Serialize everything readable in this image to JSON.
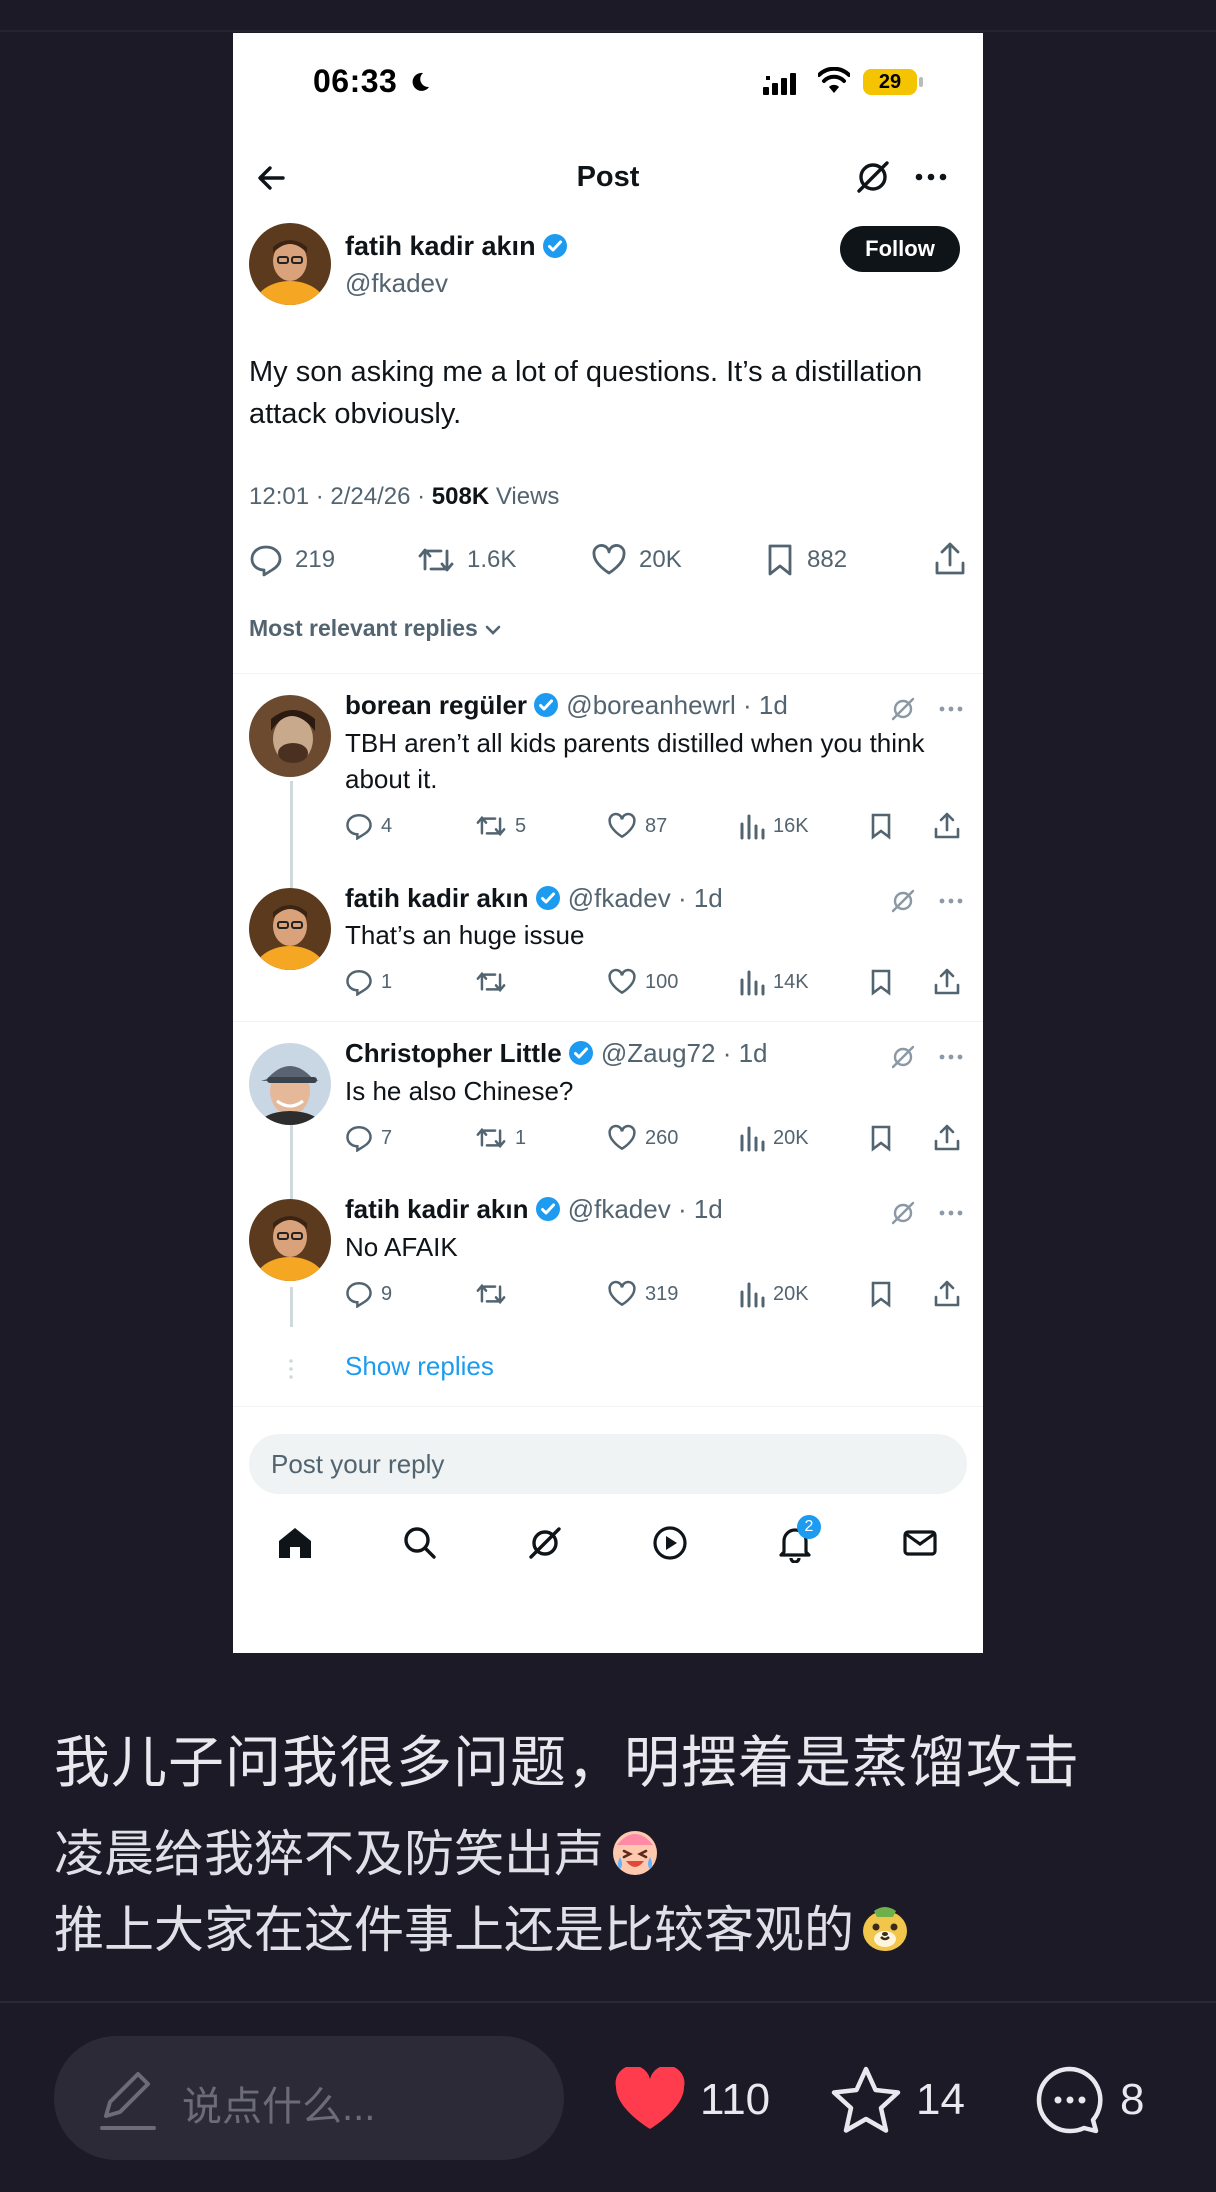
{
  "phone": {
    "status": {
      "time": "06:33",
      "battery": "29"
    },
    "nav": {
      "title": "Post"
    },
    "author": {
      "name": "fatih kadir akın",
      "handle": "@fkadev"
    },
    "follow_label": "Follow",
    "tweet_text": "My son asking me a lot of questions. It’s a distillation attack obviously.",
    "meta": {
      "time": "12:01 · 2/24/26 · ",
      "views_count": "508K",
      "views_label": " Views"
    },
    "actions": {
      "replies": "219",
      "reposts": "1.6K",
      "likes": "20K",
      "bookmarks": "882"
    },
    "sort_label": "Most relevant replies",
    "replies": [
      {
        "name": "borean regüler",
        "handle": "@boreanhewrl · 1d",
        "text": "TBH aren’t all kids parents distilled when you think about it.",
        "replies": "4",
        "reposts": "5",
        "likes": "87",
        "views": "16K"
      },
      {
        "name": "fatih kadir akın",
        "handle": "@fkadev · 1d",
        "text": "That’s an huge issue",
        "replies": "1",
        "reposts": "",
        "likes": "100",
        "views": "14K"
      },
      {
        "name": "Christopher Little",
        "handle": "@Zaug72 · 1d",
        "text": "Is he also Chinese?",
        "replies": "7",
        "reposts": "1",
        "likes": "260",
        "views": "20K"
      },
      {
        "name": "fatih kadir akın",
        "handle": "@fkadev · 1d",
        "text": "No AFAIK",
        "replies": "9",
        "reposts": "",
        "likes": "319",
        "views": "20K"
      }
    ],
    "show_replies": "Show replies",
    "reply_placeholder": "Post your reply",
    "tabs": [
      "home-icon",
      "search-icon",
      "grok-icon",
      "video-icon",
      "notifications-icon",
      "messages-icon"
    ],
    "notification_badge": "2"
  },
  "caption": {
    "title": "我儿子问我很多问题，明摆着是蒸馏攻击",
    "line1": "凌晨给我猝不及防笑出声",
    "line2": "推上大家在这件事上还是比较客观的"
  },
  "bottom": {
    "comment_placeholder": "说点什么...",
    "likes": "110",
    "favorites": "14",
    "comments": "8"
  },
  "colors": {
    "accent": "#1d9bf0",
    "background": "#1b1a26",
    "like": "#ff3b4e"
  }
}
